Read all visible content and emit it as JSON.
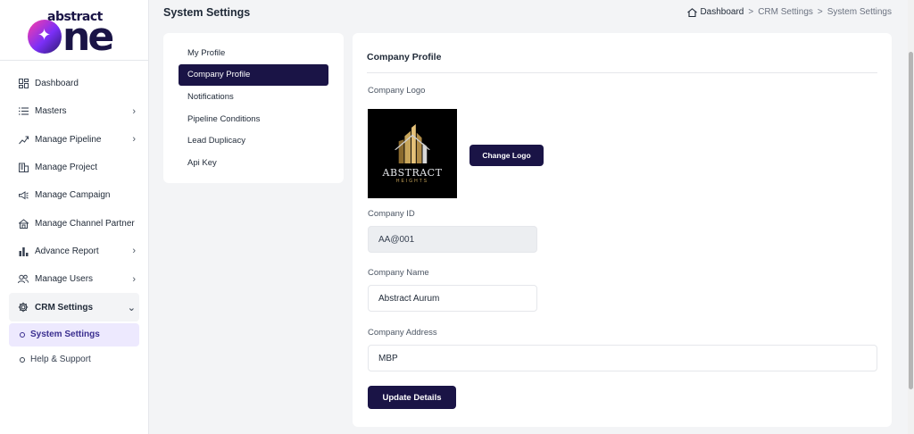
{
  "brand": {
    "logo_small": "abstract",
    "logo_big_tail": "ne"
  },
  "sidebar": {
    "items": [
      {
        "label": "Dashboard",
        "icon": "dashboard-icon",
        "has_chevron": false
      },
      {
        "label": "Masters",
        "icon": "list-icon",
        "has_chevron": true
      },
      {
        "label": "Manage Pipeline",
        "icon": "pipeline-icon",
        "has_chevron": true
      },
      {
        "label": "Manage Project",
        "icon": "building-icon",
        "has_chevron": false
      },
      {
        "label": "Manage Campaign",
        "icon": "megaphone-icon",
        "has_chevron": false
      },
      {
        "label": "Manage Channel Partner",
        "icon": "partner-icon",
        "has_chevron": false
      },
      {
        "label": "Advance Report",
        "icon": "bar-chart-icon",
        "has_chevron": true
      },
      {
        "label": "Manage Users",
        "icon": "users-icon",
        "has_chevron": true
      },
      {
        "label": "CRM Settings",
        "icon": "gear-icon",
        "has_chevron": true
      }
    ],
    "sub_active": "System Settings",
    "help": "Help & Support"
  },
  "header": {
    "title": "System Settings",
    "breadcrumb": [
      "Dashboard",
      "CRM Settings",
      "System Settings"
    ],
    "breadcrumb_sep": ">"
  },
  "submenu": {
    "items": [
      "My Profile",
      "Company Profile",
      "Notifications",
      "Pipeline Conditions",
      "Lead Duplicacy",
      "Api Key"
    ],
    "active": "Company Profile"
  },
  "profile": {
    "title": "Company Profile",
    "logo_label": "Company Logo",
    "logo_brand": "ABSTRACT",
    "logo_sub": "HEIGHTS",
    "change_logo": "Change Logo",
    "company_id_label": "Company ID",
    "company_id": "AA@001",
    "company_name_label": "Company Name",
    "company_name": "Abstract Aurum",
    "company_address_label": "Company Address",
    "company_address": "MBP",
    "update_button": "Update Details"
  },
  "colors": {
    "primary": "#1a1446",
    "active_sub_bg": "#ede9fe",
    "active_sub_text": "#3b2f8f",
    "page_bg": "#f3f4f6"
  }
}
